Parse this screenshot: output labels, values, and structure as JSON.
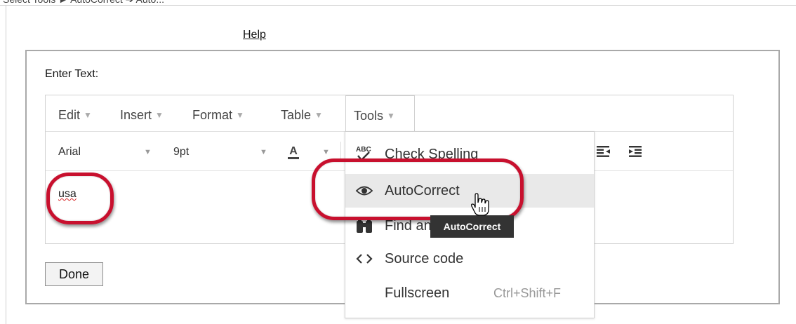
{
  "caption": "Select Tools ► AutoCorrect ➔ Auto...",
  "help_link": "Help",
  "editor_label": "Enter Text:",
  "menubar": {
    "items": [
      {
        "label": "Edit"
      },
      {
        "label": "Insert"
      },
      {
        "label": "Format"
      },
      {
        "label": "Table"
      },
      {
        "label": "Tools"
      }
    ],
    "open_menu": "Tools"
  },
  "toolbar": {
    "font_family": "Arial",
    "font_size": "9pt",
    "font_color_glyph": "A"
  },
  "editor_content": "usa",
  "tools_menu": {
    "items": [
      {
        "label": "Check Spelling",
        "icon": "spellcheck-icon"
      },
      {
        "label": "AutoCorrect",
        "icon": "eye-icon",
        "hovered": true
      },
      {
        "label": "Find and replace",
        "icon": "binoculars-icon"
      },
      {
        "label": "Source code",
        "icon": "code-icon"
      },
      {
        "label": "Fullscreen",
        "icon": "",
        "shortcut": "Ctrl+Shift+F"
      }
    ]
  },
  "tooltip": "AutoCorrect",
  "done_button": "Done",
  "colors": {
    "highlight": "#c8102e",
    "spell_error": "#d62a2a",
    "tooltip_bg": "#333333",
    "menu_hover": "#e9e9e9"
  }
}
